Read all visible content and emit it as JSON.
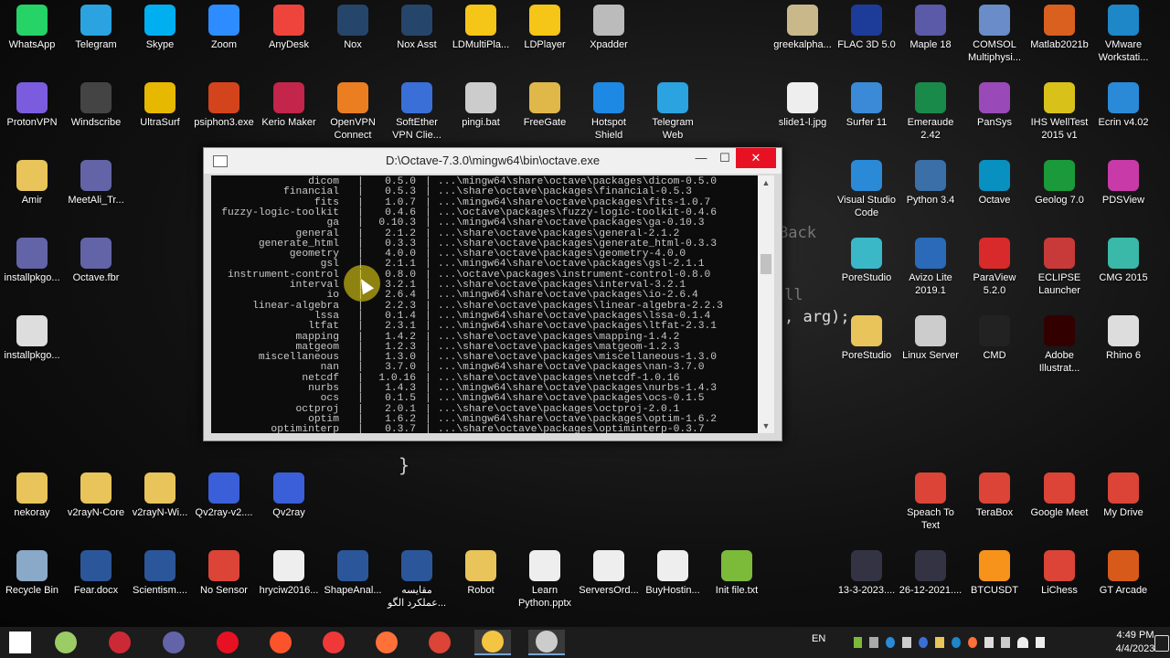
{
  "desktop_icons": [
    {
      "label": "WhatsApp",
      "icon": "whatsapp-icon",
      "color": "#25d366"
    },
    {
      "label": "Telegram",
      "icon": "telegram-icon",
      "color": "#2aa3e0"
    },
    {
      "label": "Skype",
      "icon": "skype-icon",
      "color": "#00aff0"
    },
    {
      "label": "Zoom",
      "icon": "zoom-icon",
      "color": "#2d8cff"
    },
    {
      "label": "AnyDesk",
      "icon": "anydesk-icon",
      "color": "#ef443b"
    },
    {
      "label": "Nox",
      "icon": "nox-icon",
      "color": "#26456b"
    },
    {
      "label": "Nox Asst",
      "icon": "nox-asst-icon",
      "color": "#26456b"
    },
    {
      "label": "LDMultiPla...",
      "icon": "ldmultiplayer-icon",
      "color": "#f5c518"
    },
    {
      "label": "LDPlayer",
      "icon": "ldplayer-icon",
      "color": "#f5c518"
    },
    {
      "label": "Xpadder",
      "icon": "xpadder-icon",
      "color": "#bbbbbb"
    },
    {
      "label": "ProtonVPN",
      "icon": "protonvpn-icon",
      "color": "#7b5cdf"
    },
    {
      "label": "Windscribe",
      "icon": "windscribe-icon",
      "color": "#444444"
    },
    {
      "label": "UltraSurf",
      "icon": "ultrasurf-icon",
      "color": "#e6b800"
    },
    {
      "label": "psiphon3.exe",
      "icon": "psiphon-icon",
      "color": "#d4441c"
    },
    {
      "label": "Kerio Maker",
      "icon": "kerio-icon",
      "color": "#c4254a"
    },
    {
      "label": "OpenVPN Connect",
      "icon": "openvpn-icon",
      "color": "#ea7e20"
    },
    {
      "label": "SoftEther VPN Clie...",
      "icon": "softether-icon",
      "color": "#3a6fd8"
    },
    {
      "label": "pingi.bat",
      "icon": "bat-file-icon",
      "color": "#cccccc"
    },
    {
      "label": "FreeGate",
      "icon": "freegate-icon",
      "color": "#e0b84a"
    },
    {
      "label": "Hotspot Shield",
      "icon": "hotspot-shield-icon",
      "color": "#1e88e5"
    },
    {
      "label": "Telegram Web",
      "icon": "telegram-web-icon",
      "color": "#2aa3e0"
    },
    {
      "label": "Amir",
      "icon": "folder-icon",
      "color": "#e8c45a"
    },
    {
      "label": "MeetAli_Tr...",
      "icon": "teams-icon",
      "color": "#6264a7"
    },
    {
      "label": "installpkgo...",
      "icon": "teams-icon",
      "color": "#6264a7"
    },
    {
      "label": "Octave.fbr",
      "icon": "teams-icon",
      "color": "#6264a7"
    },
    {
      "label": "installpkgo...",
      "icon": "text-file-icon",
      "color": "#dddddd"
    },
    {
      "label": "nekoray",
      "icon": "folder-icon",
      "color": "#e8c45a"
    },
    {
      "label": "v2rayN-Core",
      "icon": "folder-icon",
      "color": "#e8c45a"
    },
    {
      "label": "v2rayN-Wi...",
      "icon": "folder-icon",
      "color": "#e8c45a"
    },
    {
      "label": "Qv2ray-v2....",
      "icon": "qv2ray-icon",
      "color": "#3a5fd8"
    },
    {
      "label": "Qv2ray",
      "icon": "qv2ray-icon",
      "color": "#3a5fd8"
    },
    {
      "label": "Recycle Bin",
      "icon": "recycle-bin-icon",
      "color": "#8aa8c8"
    },
    {
      "label": "Fear.docx",
      "icon": "word-icon",
      "color": "#2b579a"
    },
    {
      "label": "Scientism....",
      "icon": "word-icon",
      "color": "#2b579a"
    },
    {
      "label": "No Sensor",
      "icon": "chrome-icon",
      "color": "#db4437"
    },
    {
      "label": "hryciw2016...",
      "icon": "document-icon",
      "color": "#eeeeee"
    },
    {
      "label": "ShapeAnal...",
      "icon": "word-icon",
      "color": "#2b579a"
    },
    {
      "label": "مقایسه عملکرد الگو...",
      "icon": "word-icon",
      "color": "#2b579a"
    },
    {
      "label": "Robot",
      "icon": "folder-icon",
      "color": "#e8c45a"
    },
    {
      "label": "Learn Python.pptx",
      "icon": "powerpoint-icon",
      "color": "#eeeeee"
    },
    {
      "label": "ServersOrd...",
      "icon": "document-icon",
      "color": "#eeeeee"
    },
    {
      "label": "BuyHostin...",
      "icon": "document-icon",
      "color": "#eeeeee"
    },
    {
      "label": "Init file.txt",
      "icon": "text-file-icon",
      "color": "#7cba3a"
    },
    {
      "label": "greekalpha...",
      "icon": "image-icon",
      "color": "#c9b98a"
    },
    {
      "label": "FLAC 3D 5.0",
      "icon": "flac3d-icon",
      "color": "#1d3c9a"
    },
    {
      "label": "Maple 18",
      "icon": "maple-icon",
      "color": "#5a5aa8"
    },
    {
      "label": "COMSOL Multiphysi...",
      "icon": "comsol-icon",
      "color": "#6a8cc8"
    },
    {
      "label": "Matlab2021b",
      "icon": "matlab-icon",
      "color": "#d9601f"
    },
    {
      "label": "VMware Workstati...",
      "icon": "vmware-icon",
      "color": "#1d87c8"
    },
    {
      "label": "slide1-l.jpg",
      "icon": "image-icon",
      "color": "#eeeeee"
    },
    {
      "label": "Surfer 11",
      "icon": "surfer-icon",
      "color": "#3a8ad8"
    },
    {
      "label": "Emeraude 2.42",
      "icon": "emeraude-icon",
      "color": "#1a8a4a"
    },
    {
      "label": "PanSys",
      "icon": "pansys-icon",
      "color": "#9a4ab8"
    },
    {
      "label": "IHS WellTest 2015 v1",
      "icon": "welltest-icon",
      "color": "#d8c21a"
    },
    {
      "label": "Ecrin v4.02",
      "icon": "ecrin-icon",
      "color": "#2a8ad8"
    },
    {
      "label": "Visual Studio Code",
      "icon": "vscode-icon",
      "color": "#2a8ad8"
    },
    {
      "label": "Python 3.4",
      "icon": "python-icon",
      "color": "#3a6fa8"
    },
    {
      "label": "Octave",
      "icon": "octave-icon",
      "color": "#0790c0"
    },
    {
      "label": "Geolog 7.0",
      "icon": "geolog-icon",
      "color": "#1a9a3a"
    },
    {
      "label": "PDSView",
      "icon": "pdsview-icon",
      "color": "#c83aa8"
    },
    {
      "label": "PoreStudio",
      "icon": "porestudio-icon",
      "color": "#3ab8c8"
    },
    {
      "label": "Avizo Lite 2019.1",
      "icon": "avizo-icon",
      "color": "#2a6ab8"
    },
    {
      "label": "ParaView 5.2.0",
      "icon": "paraview-icon",
      "color": "#d82a2a"
    },
    {
      "label": "ECLIPSE Launcher",
      "icon": "eclipse-icon",
      "color": "#c83a3a"
    },
    {
      "label": "CMG 2015",
      "icon": "cmg-icon",
      "color": "#3ab8a8"
    },
    {
      "label": "PoreStudio",
      "icon": "folder-icon",
      "color": "#e8c45a"
    },
    {
      "label": "Linux Server",
      "icon": "linux-server-icon",
      "color": "#cccccc"
    },
    {
      "label": "CMD",
      "icon": "cmd-icon",
      "color": "#222222"
    },
    {
      "label": "Adobe Illustrat...",
      "icon": "illustrator-icon",
      "color": "#330000"
    },
    {
      "label": "Rhino 6",
      "icon": "rhino-icon",
      "color": "#dddddd"
    },
    {
      "label": "Speach To Text",
      "icon": "chrome-icon",
      "color": "#db4437"
    },
    {
      "label": "TeraBox",
      "icon": "chrome-icon",
      "color": "#db4437"
    },
    {
      "label": "Google Meet",
      "icon": "chrome-icon",
      "color": "#db4437"
    },
    {
      "label": "My Drive",
      "icon": "chrome-icon",
      "color": "#db4437"
    },
    {
      "label": "13-3-2023....",
      "icon": "image-icon",
      "color": "#333344"
    },
    {
      "label": "26-12-2021....",
      "icon": "image-icon",
      "color": "#333344"
    },
    {
      "label": "BTCUSDT",
      "icon": "bitcoin-icon",
      "color": "#f7931a"
    },
    {
      "label": "LiChess",
      "icon": "chrome-icon",
      "color": "#db4437"
    },
    {
      "label": "GT Arcade",
      "icon": "gt-arcade-icon",
      "color": "#d85a1a"
    }
  ],
  "background_code": [
    ", arg);",
    "}",
    "Back",
    "ll"
  ],
  "console_window": {
    "title": "D:\\Octave-7.3.0\\mingw64\\bin\\octave.exe",
    "minimize": "—",
    "maximize": "☐",
    "close": "✕",
    "rows": [
      {
        "name": "dicom",
        "version": "0.5.0",
        "path": "...\\mingw64\\share\\octave\\packages\\dicom-0.5.0"
      },
      {
        "name": "financial",
        "version": "0.5.3",
        "path": "...\\share\\octave\\packages\\financial-0.5.3"
      },
      {
        "name": "fits",
        "version": "1.0.7",
        "path": "...\\mingw64\\share\\octave\\packages\\fits-1.0.7"
      },
      {
        "name": "fuzzy-logic-toolkit",
        "version": "0.4.6",
        "path": "...\\octave\\packages\\fuzzy-logic-toolkit-0.4.6"
      },
      {
        "name": "ga",
        "version": "0.10.3",
        "path": "...\\mingw64\\share\\octave\\packages\\ga-0.10.3"
      },
      {
        "name": "general",
        "version": "2.1.2",
        "path": "...\\share\\octave\\packages\\general-2.1.2"
      },
      {
        "name": "generate_html",
        "version": "0.3.3",
        "path": "...\\share\\octave\\packages\\generate_html-0.3.3"
      },
      {
        "name": "geometry",
        "version": "4.0.0",
        "path": "...\\share\\octave\\packages\\geometry-4.0.0"
      },
      {
        "name": "gsl",
        "version": "2.1.1",
        "path": "...\\mingw64\\share\\octave\\packages\\gsl-2.1.1"
      },
      {
        "name": "instrument-control",
        "version": "0.8.0",
        "path": "...\\octave\\packages\\instrument-control-0.8.0"
      },
      {
        "name": "interval",
        "version": "3.2.1",
        "path": "...\\share\\octave\\packages\\interval-3.2.1"
      },
      {
        "name": "io",
        "version": "2.6.4",
        "path": "...\\mingw64\\share\\octave\\packages\\io-2.6.4"
      },
      {
        "name": "linear-algebra",
        "version": "2.2.3",
        "path": "...\\share\\octave\\packages\\linear-algebra-2.2.3"
      },
      {
        "name": "lssa",
        "version": "0.1.4",
        "path": "...\\mingw64\\share\\octave\\packages\\lssa-0.1.4"
      },
      {
        "name": "ltfat",
        "version": "2.3.1",
        "path": "...\\mingw64\\share\\octave\\packages\\ltfat-2.3.1"
      },
      {
        "name": "mapping",
        "version": "1.4.2",
        "path": "...\\share\\octave\\packages\\mapping-1.4.2"
      },
      {
        "name": "matgeom",
        "version": "1.2.3",
        "path": "...\\share\\octave\\packages\\matgeom-1.2.3"
      },
      {
        "name": "miscellaneous",
        "version": "1.3.0",
        "path": "...\\share\\octave\\packages\\miscellaneous-1.3.0"
      },
      {
        "name": "nan",
        "version": "3.7.0",
        "path": "...\\mingw64\\share\\octave\\packages\\nan-3.7.0"
      },
      {
        "name": "netcdf",
        "version": "1.0.16",
        "path": "...\\share\\octave\\packages\\netcdf-1.0.16"
      },
      {
        "name": "nurbs",
        "version": "1.4.3",
        "path": "...\\mingw64\\share\\octave\\packages\\nurbs-1.4.3"
      },
      {
        "name": "ocs",
        "version": "0.1.5",
        "path": "...\\mingw64\\share\\octave\\packages\\ocs-0.1.5"
      },
      {
        "name": "octproj",
        "version": "2.0.1",
        "path": "...\\share\\octave\\packages\\octproj-2.0.1"
      },
      {
        "name": "optim",
        "version": "1.6.2",
        "path": "...\\mingw64\\share\\octave\\packages\\optim-1.6.2"
      },
      {
        "name": "optiminterp",
        "version": "0.3.7",
        "path": "...\\share\\octave\\packages\\optiminterp-0.3.7"
      }
    ]
  },
  "taskbar": {
    "items": [
      {
        "icon": "windows-start-icon",
        "color": "#ffffff"
      },
      {
        "icon": "file-manager-icon",
        "color": "#9ccc65"
      },
      {
        "icon": "zotero-icon",
        "color": "#cc2936"
      },
      {
        "icon": "teams-icon",
        "color": "#6264a7"
      },
      {
        "icon": "record-icon",
        "color": "#e81123"
      },
      {
        "icon": "brave-icon",
        "color": "#fb542b"
      },
      {
        "icon": "vivaldi-icon",
        "color": "#ef3939"
      },
      {
        "icon": "firefox-icon",
        "color": "#ff7139"
      },
      {
        "icon": "chrome-icon",
        "color": "#db4437"
      },
      {
        "icon": "file-explorer-icon",
        "color": "#f4c542"
      },
      {
        "icon": "console-window-icon",
        "color": "#cccccc"
      }
    ],
    "language": "EN",
    "time": "4:49 PM",
    "date": "4/4/2023"
  }
}
